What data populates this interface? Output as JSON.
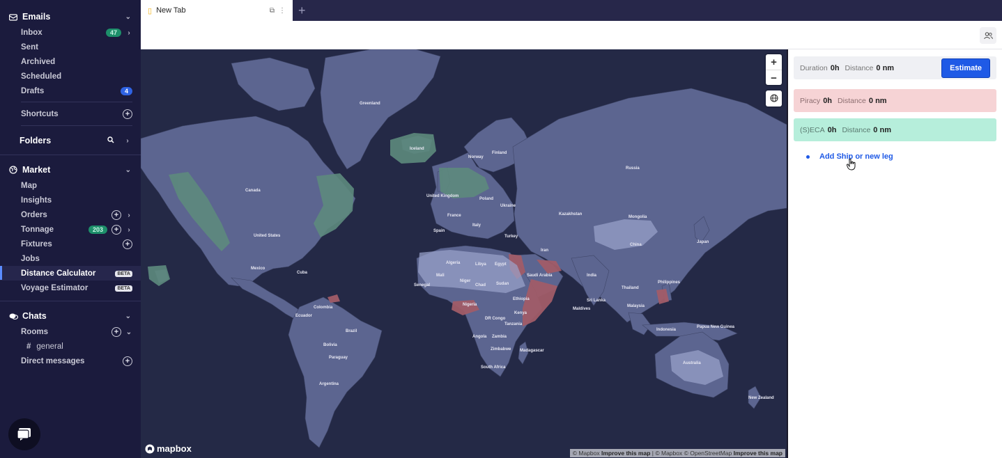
{
  "sidebar": {
    "emails": {
      "title": "Emails",
      "items": [
        {
          "label": "Inbox",
          "badge": "47"
        },
        {
          "label": "Sent"
        },
        {
          "label": "Archived"
        },
        {
          "label": "Scheduled"
        },
        {
          "label": "Drafts",
          "badge": "4"
        }
      ],
      "shortcuts": "Shortcuts"
    },
    "folders": {
      "title": "Folders"
    },
    "market": {
      "title": "Market",
      "items": [
        {
          "label": "Map"
        },
        {
          "label": "Insights"
        },
        {
          "label": "Orders"
        },
        {
          "label": "Tonnage",
          "badge": "203"
        },
        {
          "label": "Fixtures"
        },
        {
          "label": "Jobs"
        },
        {
          "label": "Distance Calculator",
          "badge": "BETA"
        },
        {
          "label": "Voyage Estimator",
          "badge": "BETA"
        }
      ]
    },
    "chats": {
      "title": "Chats",
      "rooms": "Rooms",
      "channel": "general",
      "direct": "Direct messages"
    }
  },
  "tabs": [
    {
      "label": "New Tab"
    }
  ],
  "map": {
    "zoom_in": "+",
    "zoom_out": "−",
    "logo": "mapbox",
    "attribution": {
      "a1": "© Mapbox",
      "a2": "Improve this map",
      "sep": "|",
      "a3": "© Mapbox © OpenStreetMap",
      "a4": "Improve this map"
    },
    "labels": {
      "greenland": "Greenland",
      "iceland": "Iceland",
      "canada": "Canada",
      "usa": "United States",
      "mexico": "Mexico",
      "cuba": "Cuba",
      "colombia": "Colombia",
      "ecuador": "Ecuador",
      "brazil": "Brazil",
      "bolivia": "Bolivia",
      "paraguay": "Paraguay",
      "argentina": "Argentina",
      "uk": "United Kingdom",
      "spain": "Spain",
      "france": "France",
      "italy": "Italy",
      "poland": "Poland",
      "ukraine": "Ukraine",
      "turkey": "Turkey",
      "russia": "Russia",
      "kazakhstan": "Kazakhstan",
      "mongolia": "Mongolia",
      "china": "China",
      "japan": "Japan",
      "india": "India",
      "iran": "Iran",
      "saudi": "Saudi Arabia",
      "egypt": "Egypt",
      "libya": "Libya",
      "algeria": "Algeria",
      "mali": "Mali",
      "niger": "Niger",
      "chad": "Chad",
      "sudan": "Sudan",
      "ethiopia": "Ethiopia",
      "nigeria": "Nigeria",
      "senegal": "Senegal",
      "drc": "DR Congo",
      "kenya": "Kenya",
      "tanzania": "Tanzania",
      "angola": "Angola",
      "zambia": "Zambia",
      "zimbabwe": "Zimbabwe",
      "madagascar": "Madagascar",
      "southafrica": "South Africa",
      "maldives": "Maldives",
      "srilanka": "Sri Lanka",
      "thailand": "Thailand",
      "malaysia": "Malaysia",
      "indonesia": "Indonesia",
      "philippines": "Philippines",
      "png": "Papua New Guinea",
      "australia": "Australia",
      "newzealand": "New Zealand",
      "finland": "Finland",
      "norway": "Norway"
    }
  },
  "panel": {
    "duration_label": "Duration",
    "duration_value": "0h",
    "distance_label": "Distance",
    "distance_value": "0 nm",
    "estimate": "Estimate",
    "piracy_label": "Piracy",
    "piracy_value": "0h",
    "seca_label": "(S)ECA",
    "seca_value": "0h",
    "add_ship": "Add Ship or new leg"
  },
  "colors": {
    "accent": "#1f5ae6",
    "piracy": "#f6d3d5",
    "seca": "#b6eedb",
    "land": "#5c6590",
    "ocean": "#242946",
    "sidebar": "#1b1b3d"
  }
}
